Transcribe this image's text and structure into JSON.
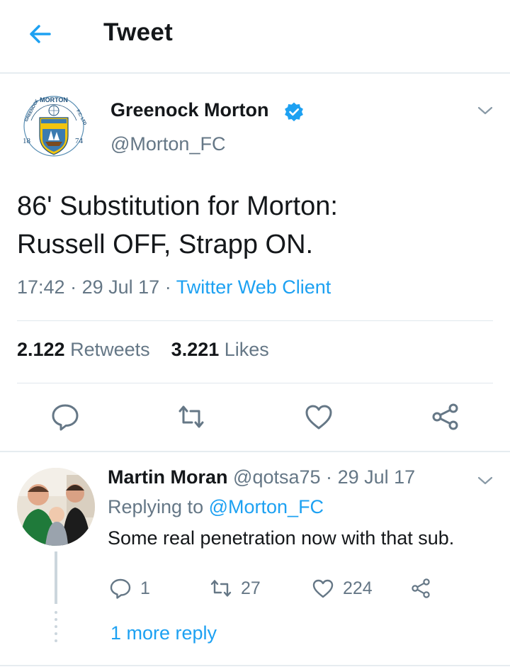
{
  "header": {
    "title": "Tweet",
    "back_icon": "arrow-left-icon"
  },
  "colors": {
    "accent": "#1da1f2",
    "muted": "#657786",
    "text": "#14171a",
    "divider": "#e1e8ed"
  },
  "tweet": {
    "author_name": "Greenock Morton",
    "author_handle": "@Morton_FC",
    "logo": {
      "name": "Greenock Morton crest",
      "text_top": "MORTON",
      "text_left": "GREENOCK",
      "text_right": "F.C. LTD",
      "year_left": "18",
      "year_right": "74"
    },
    "text_line1": "86' Substitution for Morton:",
    "text_line2": "Russell OFF, Strapp ON.",
    "time": "17:42",
    "date": "29 Jul 17",
    "source": "Twitter Web Client",
    "retweets_count": "2.122",
    "retweets_label": "Retweets",
    "likes_count": "3.221",
    "likes_label": "Likes"
  },
  "reply": {
    "author_name": "Martin Moran",
    "author_handle": "@qotsa75",
    "date": "29 Jul 17",
    "replying_prefix": "Replying to",
    "replying_handle": "@Morton_FC",
    "text": "Some real penetration now with that sub.",
    "reply_count": "1",
    "retweet_count": "27",
    "like_count": "224",
    "more_replies": "1 more reply"
  }
}
